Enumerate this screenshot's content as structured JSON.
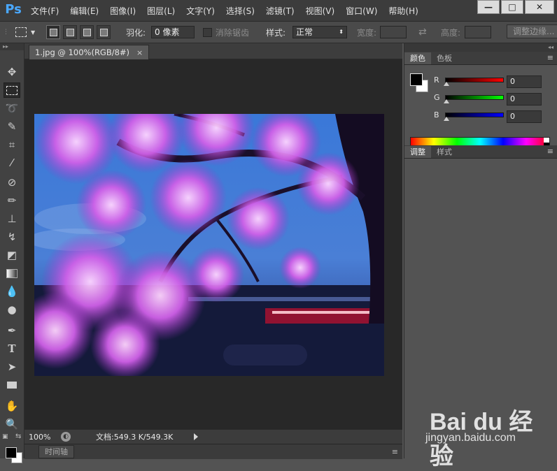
{
  "app": {
    "logo": "Ps"
  },
  "menu": [
    "文件(F)",
    "编辑(E)",
    "图像(I)",
    "图层(L)",
    "文字(Y)",
    "选择(S)",
    "滤镜(T)",
    "视图(V)",
    "窗口(W)",
    "帮助(H)"
  ],
  "window_controls": {
    "minimize": "—",
    "maximize": "□",
    "close": "✕"
  },
  "options": {
    "feather_label": "羽化:",
    "feather_value": "0 像素",
    "antialias_label": "消除锯齿",
    "style_label": "样式:",
    "style_value": "正常",
    "width_label": "宽度:",
    "height_label": "高度:",
    "refine_edge": "调整边缘..."
  },
  "document": {
    "tab_title": "1.jpg @ 100%(RGB/8#)",
    "close": "×",
    "zoom": "100%",
    "doc_info": "文档:549.3 K/549.3K"
  },
  "timeline": {
    "tab": "时间轴"
  },
  "color_panel": {
    "tabs": [
      "颜色",
      "色板"
    ],
    "channels": [
      {
        "label": "R",
        "value": "0",
        "color": "#ff0000"
      },
      {
        "label": "G",
        "value": "0",
        "color": "#00ff00"
      },
      {
        "label": "B",
        "value": "0",
        "color": "#0000ff"
      }
    ],
    "foreground": "#000000",
    "background": "#ffffff"
  },
  "adjust_panel": {
    "tabs": [
      "调整",
      "样式"
    ]
  },
  "tools": [
    "move-tool-icon",
    "marquee-tool-icon",
    "lasso-tool-icon",
    "quick-select-tool-icon",
    "crop-tool-icon",
    "eyedropper-tool-icon",
    "healing-brush-icon",
    "brush-tool-icon",
    "clone-stamp-icon",
    "history-brush-icon",
    "eraser-tool-icon",
    "gradient-tool-icon",
    "blur-tool-icon",
    "dodge-tool-icon",
    "pen-tool-icon",
    "type-tool-icon",
    "path-select-icon",
    "rectangle-tool-icon",
    "hand-tool-icon",
    "zoom-tool-icon"
  ],
  "watermark": {
    "brand": "Bai du 经验",
    "url": "jingyan.baidu.com"
  }
}
